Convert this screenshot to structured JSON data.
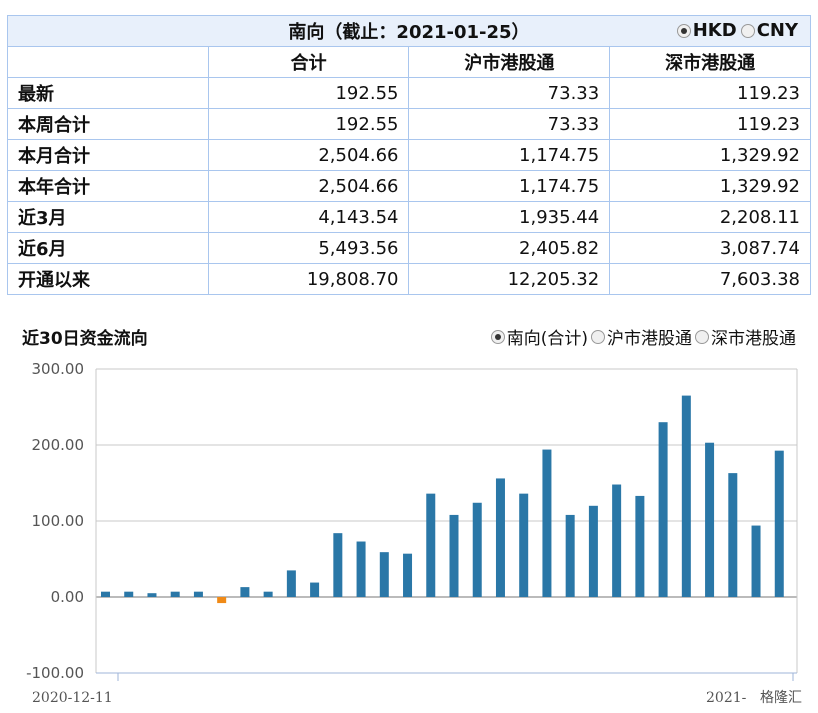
{
  "table": {
    "title": "南向（截止：2021-01-25）",
    "currency_options": [
      {
        "label": "HKD",
        "selected": true
      },
      {
        "label": "CNY",
        "selected": false
      }
    ],
    "headers": [
      "",
      "合计",
      "沪市港股通",
      "深市港股通"
    ],
    "rows": [
      {
        "label": "最新",
        "values": [
          "192.55",
          "73.33",
          "119.23"
        ]
      },
      {
        "label": "本周合计",
        "values": [
          "192.55",
          "73.33",
          "119.23"
        ]
      },
      {
        "label": "本月合计",
        "values": [
          "2,504.66",
          "1,174.75",
          "1,329.92"
        ]
      },
      {
        "label": "本年合计",
        "values": [
          "2,504.66",
          "1,174.75",
          "1,329.92"
        ]
      },
      {
        "label": "近3月",
        "values": [
          "4,143.54",
          "1,935.44",
          "2,208.11"
        ]
      },
      {
        "label": "近6月",
        "values": [
          "5,493.56",
          "2,405.82",
          "3,087.74"
        ]
      },
      {
        "label": "开通以来",
        "values": [
          "19,808.70",
          "12,205.32",
          "7,603.38"
        ]
      }
    ]
  },
  "chart_section": {
    "title": "近30日资金流向",
    "series_options": [
      {
        "label": "南向(合计)",
        "selected": true
      },
      {
        "label": "沪市港股通",
        "selected": false
      },
      {
        "label": "深市港股通",
        "selected": false
      }
    ],
    "watermark": "格隆汇"
  },
  "chart_data": {
    "type": "bar",
    "ylim": [
      -100,
      300
    ],
    "yticks": [
      "300.00",
      "200.00",
      "100.00",
      "0.00",
      "-100.00"
    ],
    "x_labels": {
      "start": "2020-12-11",
      "end": "2021-"
    },
    "values": [
      7,
      7,
      5,
      7,
      7,
      -8,
      13,
      7,
      35,
      19,
      84,
      73,
      59,
      57,
      136,
      108,
      124,
      156,
      136,
      194,
      108,
      120,
      148,
      133,
      230,
      265,
      203,
      163,
      94,
      192.55
    ],
    "colors": {
      "positive": "#2a77a7",
      "negative": "#f08a17"
    }
  }
}
